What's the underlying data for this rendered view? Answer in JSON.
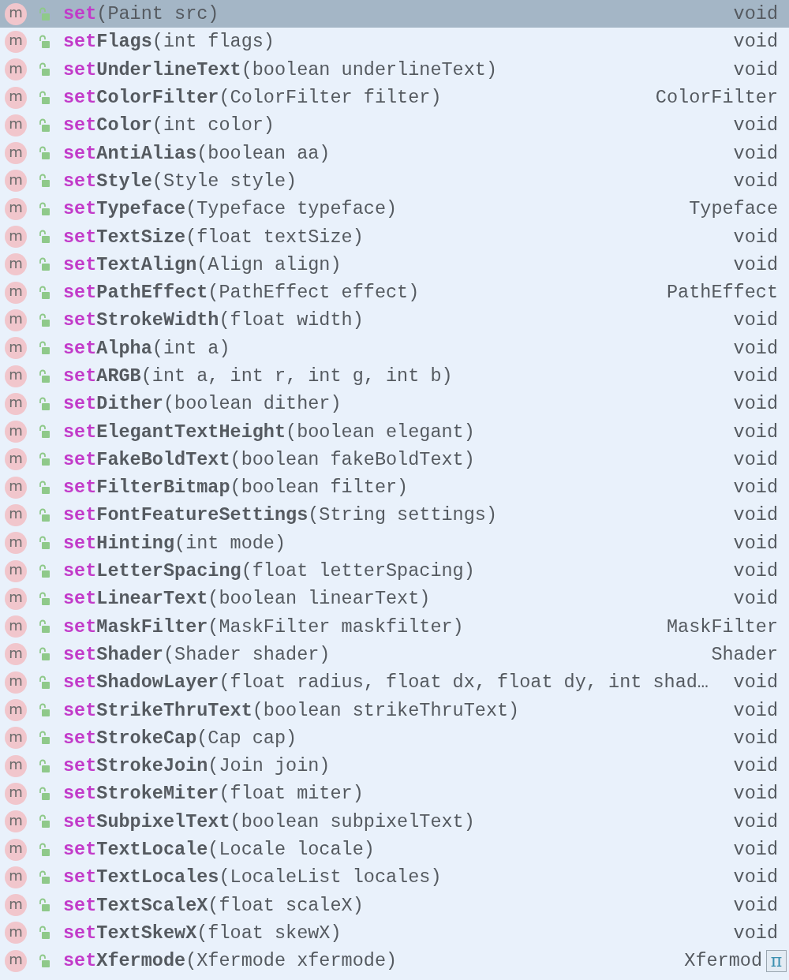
{
  "completion_list": {
    "items": [
      {
        "badge": "m",
        "match": "set",
        "params": "(Paint src)",
        "type": "void",
        "selected": true
      },
      {
        "badge": "m",
        "match": "set",
        "name": "Flags",
        "params": "(int flags)",
        "type": "void",
        "selected": false
      },
      {
        "badge": "m",
        "match": "set",
        "name": "UnderlineText",
        "params": "(boolean underlineText)",
        "type": "void",
        "selected": false
      },
      {
        "badge": "m",
        "match": "set",
        "name": "ColorFilter",
        "params": "(ColorFilter filter)",
        "type": "ColorFilter",
        "selected": false
      },
      {
        "badge": "m",
        "match": "set",
        "name": "Color",
        "params": "(int color)",
        "type": "void",
        "selected": false
      },
      {
        "badge": "m",
        "match": "set",
        "name": "AntiAlias",
        "params": "(boolean aa)",
        "type": "void",
        "selected": false
      },
      {
        "badge": "m",
        "match": "set",
        "name": "Style",
        "params": "(Style style)",
        "type": "void",
        "selected": false
      },
      {
        "badge": "m",
        "match": "set",
        "name": "Typeface",
        "params": "(Typeface typeface)",
        "type": "Typeface",
        "selected": false
      },
      {
        "badge": "m",
        "match": "set",
        "name": "TextSize",
        "params": "(float textSize)",
        "type": "void",
        "selected": false
      },
      {
        "badge": "m",
        "match": "set",
        "name": "TextAlign",
        "params": "(Align align)",
        "type": "void",
        "selected": false
      },
      {
        "badge": "m",
        "match": "set",
        "name": "PathEffect",
        "params": "(PathEffect effect)",
        "type": "PathEffect",
        "selected": false
      },
      {
        "badge": "m",
        "match": "set",
        "name": "StrokeWidth",
        "params": "(float width)",
        "type": "void",
        "selected": false
      },
      {
        "badge": "m",
        "match": "set",
        "name": "Alpha",
        "params": "(int a)",
        "type": "void",
        "selected": false
      },
      {
        "badge": "m",
        "match": "set",
        "name": "ARGB",
        "params": "(int a, int r, int g, int b)",
        "type": "void",
        "selected": false
      },
      {
        "badge": "m",
        "match": "set",
        "name": "Dither",
        "params": "(boolean dither)",
        "type": "void",
        "selected": false
      },
      {
        "badge": "m",
        "match": "set",
        "name": "ElegantTextHeight",
        "params": "(boolean elegant)",
        "type": "void",
        "selected": false
      },
      {
        "badge": "m",
        "match": "set",
        "name": "FakeBoldText",
        "params": "(boolean fakeBoldText)",
        "type": "void",
        "selected": false
      },
      {
        "badge": "m",
        "match": "set",
        "name": "FilterBitmap",
        "params": "(boolean filter)",
        "type": "void",
        "selected": false
      },
      {
        "badge": "m",
        "match": "set",
        "name": "FontFeatureSettings",
        "params": "(String settings)",
        "type": "void",
        "selected": false
      },
      {
        "badge": "m",
        "match": "set",
        "name": "Hinting",
        "params": "(int mode)",
        "type": "void",
        "selected": false
      },
      {
        "badge": "m",
        "match": "set",
        "name": "LetterSpacing",
        "params": "(float letterSpacing)",
        "type": "void",
        "selected": false
      },
      {
        "badge": "m",
        "match": "set",
        "name": "LinearText",
        "params": "(boolean linearText)",
        "type": "void",
        "selected": false
      },
      {
        "badge": "m",
        "match": "set",
        "name": "MaskFilter",
        "params": "(MaskFilter maskfilter)",
        "type": "MaskFilter",
        "selected": false
      },
      {
        "badge": "m",
        "match": "set",
        "name": "Shader",
        "params": "(Shader shader)",
        "type": "Shader",
        "selected": false
      },
      {
        "badge": "m",
        "match": "set",
        "name": "ShadowLayer",
        "params": "(float radius, float dx, float dy, int shad…",
        "type": "void",
        "selected": false
      },
      {
        "badge": "m",
        "match": "set",
        "name": "StrikeThruText",
        "params": "(boolean strikeThruText)",
        "type": "void",
        "selected": false
      },
      {
        "badge": "m",
        "match": "set",
        "name": "StrokeCap",
        "params": "(Cap cap)",
        "type": "void",
        "selected": false
      },
      {
        "badge": "m",
        "match": "set",
        "name": "StrokeJoin",
        "params": "(Join join)",
        "type": "void",
        "selected": false
      },
      {
        "badge": "m",
        "match": "set",
        "name": "StrokeMiter",
        "params": "(float miter)",
        "type": "void",
        "selected": false
      },
      {
        "badge": "m",
        "match": "set",
        "name": "SubpixelText",
        "params": "(boolean subpixelText)",
        "type": "void",
        "selected": false
      },
      {
        "badge": "m",
        "match": "set",
        "name": "TextLocale",
        "params": "(Locale locale)",
        "type": "void",
        "selected": false
      },
      {
        "badge": "m",
        "match": "set",
        "name": "TextLocales",
        "params": "(LocaleList locales)",
        "type": "void",
        "selected": false
      },
      {
        "badge": "m",
        "match": "set",
        "name": "TextScaleX",
        "params": "(float scaleX)",
        "type": "void",
        "selected": false
      },
      {
        "badge": "m",
        "match": "set",
        "name": "TextSkewX",
        "params": "(float skewX)",
        "type": "void",
        "selected": false
      },
      {
        "badge": "m",
        "match": "set",
        "name": "Xfermode",
        "params": "(Xfermode xfermode)",
        "type": "Xfermod",
        "selected": false
      }
    ]
  },
  "pi_button": {
    "label": "π"
  }
}
